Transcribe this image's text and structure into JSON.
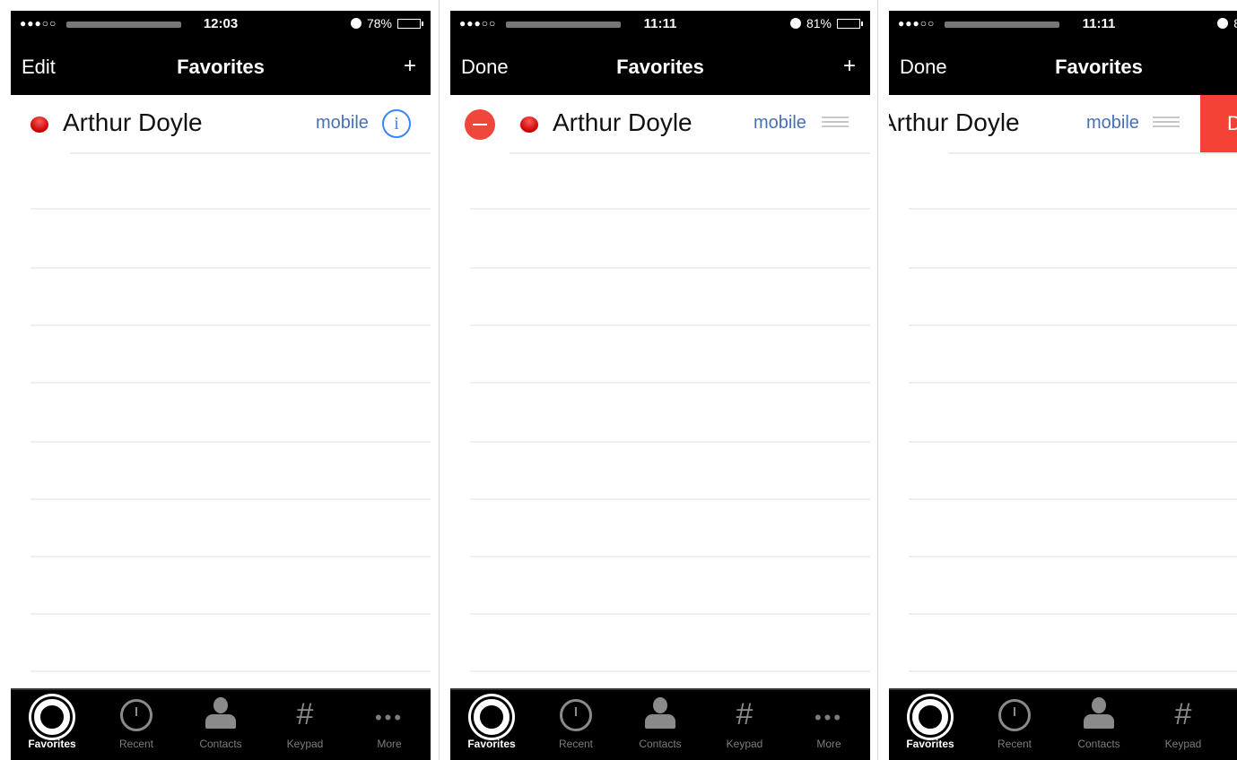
{
  "tabs": [
    {
      "label": "Favorites",
      "icon": "gear-icon",
      "active": true
    },
    {
      "label": "Recent",
      "icon": "clock-icon",
      "active": false
    },
    {
      "label": "Contacts",
      "icon": "person-icon",
      "active": false
    },
    {
      "label": "Keypad",
      "icon": "keypad-icon",
      "active": false
    },
    {
      "label": "More",
      "icon": "more-icon",
      "active": false
    }
  ],
  "keypad_glyph": "#",
  "more_glyph": "•••",
  "screens": [
    {
      "status": {
        "signal": "●●●○○",
        "time": "12:03",
        "battery": "78%"
      },
      "nav": {
        "left": "Edit",
        "title": "Favorites",
        "right": "+"
      },
      "contact": {
        "name": "Arthur Doyle",
        "type": "mobile",
        "info": "i"
      }
    },
    {
      "status": {
        "signal": "●●●○○",
        "time": "11:11",
        "battery": "81%"
      },
      "nav": {
        "left": "Done",
        "title": "Favorites",
        "right": "+"
      },
      "contact": {
        "name": "Arthur Doyle",
        "type": "mobile"
      }
    },
    {
      "status": {
        "signal": "●●●○○",
        "time": "11:11",
        "battery": "8"
      },
      "nav": {
        "left": "Done",
        "title": "Favorites"
      },
      "contact": {
        "name": "Arthur Doyle",
        "type": "mobile",
        "delete_label": "D"
      }
    }
  ],
  "colors": {
    "delete": "#f44336",
    "accent": "#3a86ff",
    "link": "#4a6fb5",
    "favorite": "#c80000"
  }
}
